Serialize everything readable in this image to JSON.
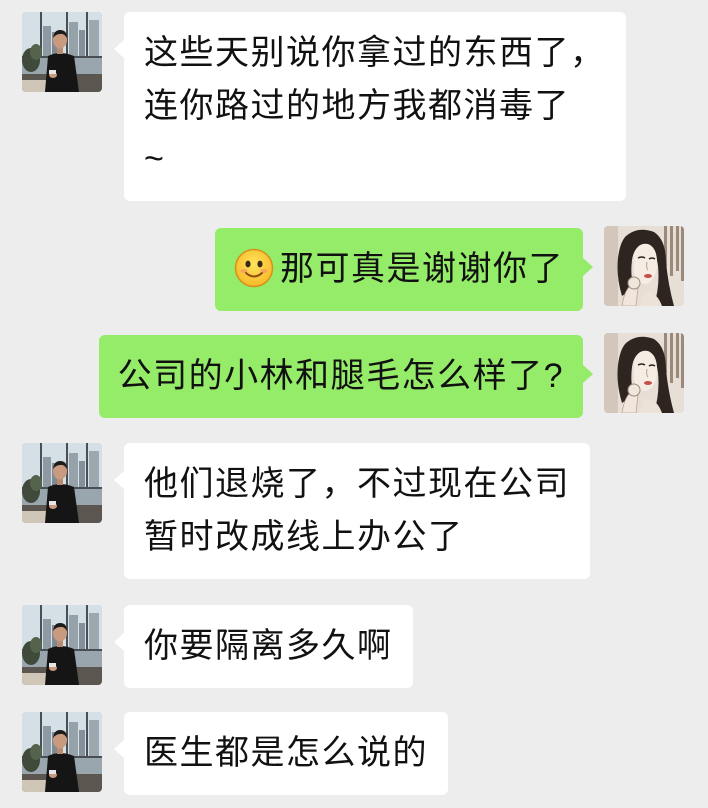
{
  "app": {
    "background": "#ededed"
  },
  "messages": [
    {
      "avatar_icon": "man-avatar-icon",
      "bubble_color": "#ffffff",
      "lines": [
        "这些天别说你拿过的东西了，",
        "连你路过的地方我都消毒了",
        "~"
      ]
    },
    {
      "avatar_icon": "woman-avatar-icon",
      "bubble_color": "#95ec69",
      "emoji_icon": "smile-emoji-icon",
      "lines": [
        "那可真是谢谢你了"
      ]
    },
    {
      "avatar_icon": "woman-avatar-icon",
      "bubble_color": "#95ec69",
      "lines": [
        "公司的小林和腿毛怎么样了?"
      ]
    },
    {
      "avatar_icon": "man-avatar-icon",
      "bubble_color": "#ffffff",
      "lines": [
        "他们退烧了，不过现在公司",
        "暂时改成线上办公了"
      ]
    },
    {
      "avatar_icon": "man-avatar-icon",
      "bubble_color": "#ffffff",
      "lines": [
        "你要隔离多久啊"
      ]
    },
    {
      "avatar_icon": "man-avatar-icon",
      "bubble_color": "#ffffff",
      "lines": [
        "医生都是怎么说的"
      ]
    }
  ]
}
